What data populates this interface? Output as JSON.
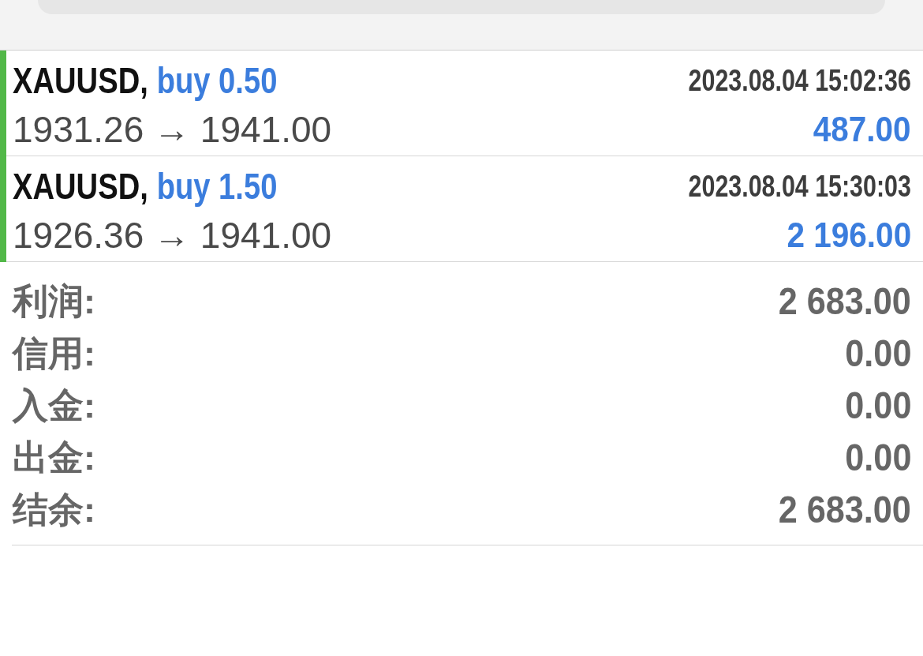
{
  "positions": [
    {
      "symbol": "XAUUSD,",
      "order": "buy 0.50",
      "time": "2023.08.04 15:02:36",
      "prices": "1931.26 → 1941.00",
      "profit": "487.00",
      "color": "#52b848"
    },
    {
      "symbol": "XAUUSD,",
      "order": "buy 1.50",
      "time": "2023.08.04 15:30:03",
      "prices": "1926.36 → 1941.00",
      "profit": "2 196.00",
      "color": "#52b848"
    }
  ],
  "summary": [
    {
      "label": "利润:",
      "value": "2 683.00"
    },
    {
      "label": "信用:",
      "value": "0.00"
    },
    {
      "label": "入金:",
      "value": "0.00"
    },
    {
      "label": "出金:",
      "value": "0.00"
    },
    {
      "label": "结余:",
      "value": "2 683.00"
    }
  ]
}
